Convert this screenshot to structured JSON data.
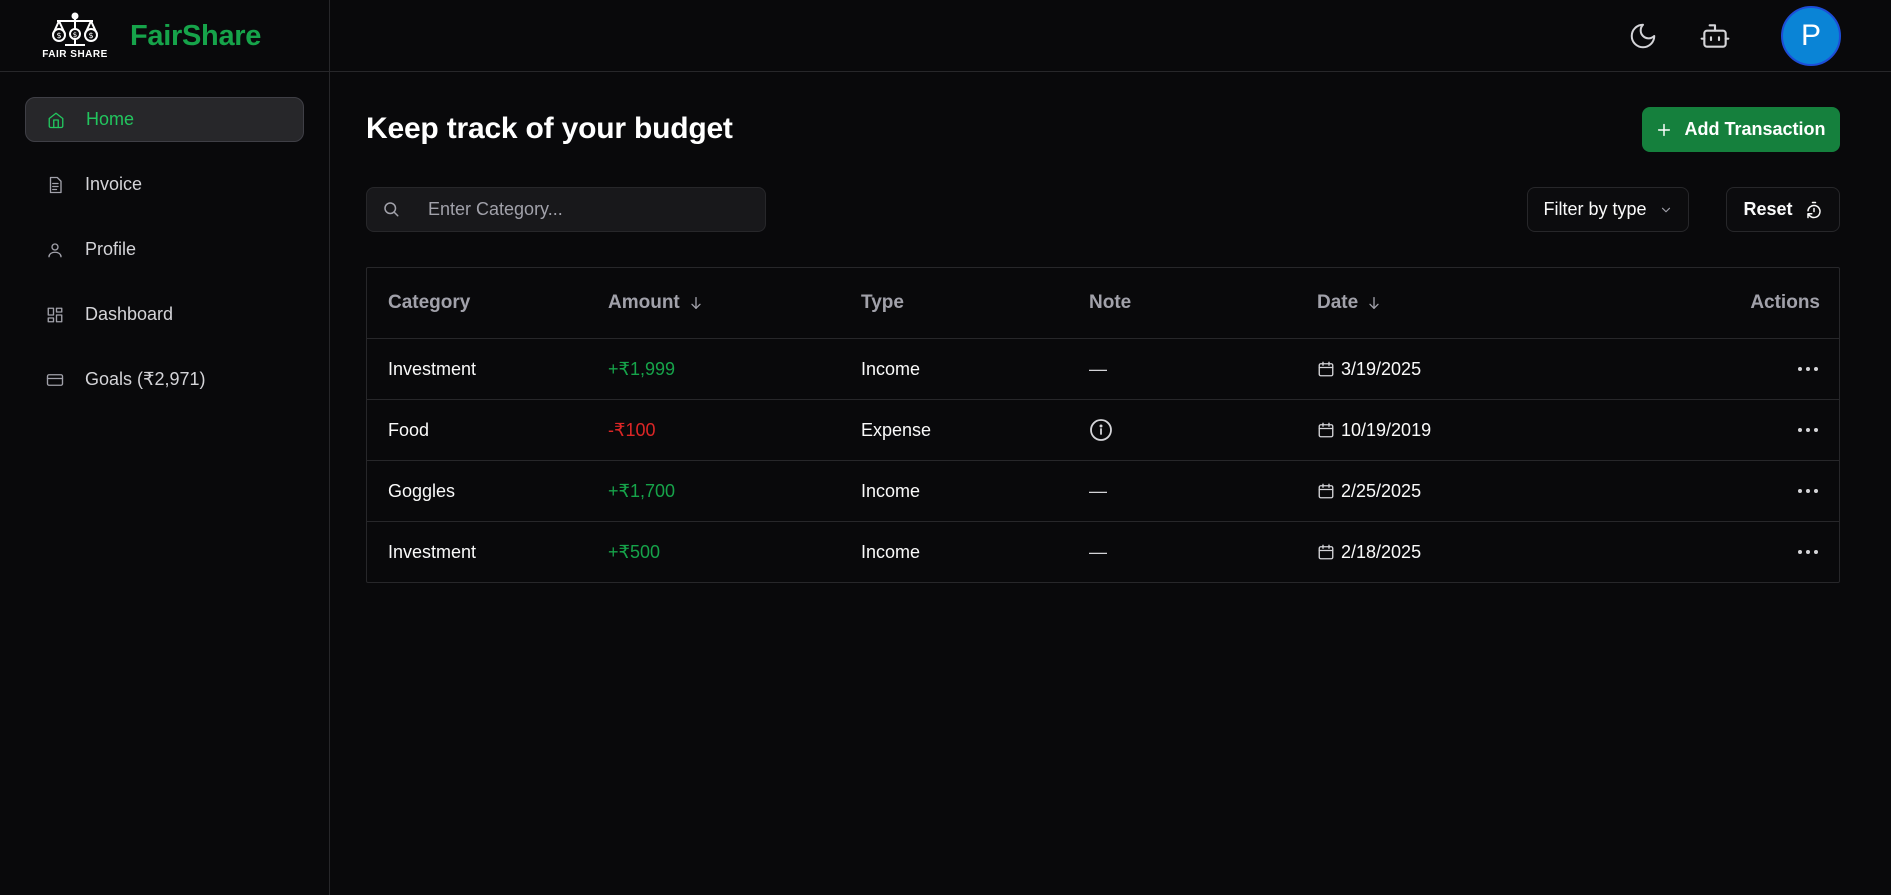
{
  "brand": {
    "logo_text": "FAIR SHARE",
    "name": "FairShare",
    "accent": "#16a34a"
  },
  "topbar": {
    "theme_icon": "moon-icon",
    "assistant_icon": "bot-icon",
    "avatar_initial": "P",
    "avatar_color": "#0a84d6"
  },
  "sidebar": {
    "items": [
      {
        "label": "Home",
        "icon": "home-icon",
        "active": true
      },
      {
        "label": "Invoice",
        "icon": "invoice-icon",
        "active": false
      },
      {
        "label": "Profile",
        "icon": "user-icon",
        "active": false
      },
      {
        "label": "Dashboard",
        "icon": "dashboard-icon",
        "active": false
      },
      {
        "label": "Goals (₹2,971)",
        "icon": "card-icon",
        "active": false
      }
    ]
  },
  "main": {
    "title": "Keep track of your budget",
    "add_button": "Add Transaction",
    "search_placeholder": "Enter Category...",
    "filter_label": "Filter by type",
    "reset_label": "Reset"
  },
  "table": {
    "columns": {
      "category": "Category",
      "amount": "Amount",
      "type": "Type",
      "note": "Note",
      "date": "Date",
      "actions": "Actions"
    },
    "rows": [
      {
        "category": "Investment",
        "amount": "+₹1,999",
        "type": "Income",
        "note": "—",
        "date": "3/19/2025"
      },
      {
        "category": "Food",
        "amount": "-₹100",
        "type": "Expense",
        "note": "info",
        "date": "10/19/2019"
      },
      {
        "category": "Goggles",
        "amount": "+₹1,700",
        "type": "Income",
        "note": "—",
        "date": "2/25/2025"
      },
      {
        "category": "Investment",
        "amount": "+₹500",
        "type": "Income",
        "note": "—",
        "date": "2/18/2025"
      }
    ]
  },
  "colors": {
    "positive": "#16a34a",
    "negative": "#dc2626",
    "background": "#09090b",
    "border": "#27272a"
  }
}
